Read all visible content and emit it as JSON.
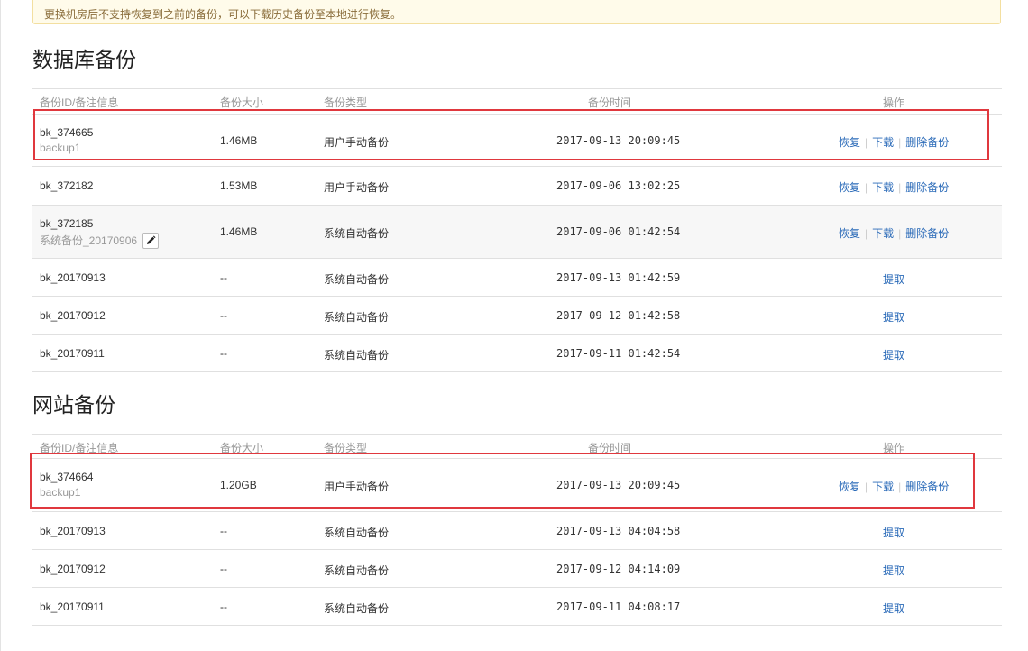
{
  "notice": "更换机房后不支持恢复到之前的备份，可以下载历史备份至本地进行恢复。",
  "headers": {
    "id": "备份ID/备注信息",
    "size": "备份大小",
    "type": "备份类型",
    "time": "备份时间",
    "ops": "操作"
  },
  "db": {
    "title": "数据库备份",
    "rows": [
      {
        "id": "bk_374665",
        "note": "backup1",
        "size": "1.46MB",
        "type": "用户手动备份",
        "time": "2017-09-13 20:09:45"
      },
      {
        "id": "bk_372182",
        "size": "1.53MB",
        "type": "用户手动备份",
        "time": "2017-09-06 13:02:25"
      },
      {
        "id": "bk_372185",
        "note": "系统备份_20170906",
        "size": "1.46MB",
        "type": "系统自动备份",
        "time": "2017-09-06 01:42:54"
      },
      {
        "id": "bk_20170913",
        "size": "--",
        "type": "系统自动备份",
        "time": "2017-09-13 01:42:59"
      },
      {
        "id": "bk_20170912",
        "size": "--",
        "type": "系统自动备份",
        "time": "2017-09-12 01:42:58"
      },
      {
        "id": "bk_20170911",
        "size": "--",
        "type": "系统自动备份",
        "time": "2017-09-11 01:42:54"
      }
    ]
  },
  "site": {
    "title": "网站备份",
    "rows": [
      {
        "id": "bk_374664",
        "note": "backup1",
        "size": "1.20GB",
        "type": "用户手动备份",
        "time": "2017-09-13 20:09:45"
      },
      {
        "id": "bk_20170913",
        "size": "--",
        "type": "系统自动备份",
        "time": "2017-09-13 04:04:58"
      },
      {
        "id": "bk_20170912",
        "size": "--",
        "type": "系统自动备份",
        "time": "2017-09-12 04:14:09"
      },
      {
        "id": "bk_20170911",
        "size": "--",
        "type": "系统自动备份",
        "time": "2017-09-11 04:08:17"
      }
    ]
  },
  "actions": {
    "restore": "恢复",
    "download": "下载",
    "delete": "删除备份",
    "fetch": "提取"
  },
  "icons": {
    "edit": "pencil-icon"
  },
  "colors": {
    "link": "#2a6ab8",
    "highlight": "#e0383e",
    "notice_bg": "#fffbea"
  }
}
